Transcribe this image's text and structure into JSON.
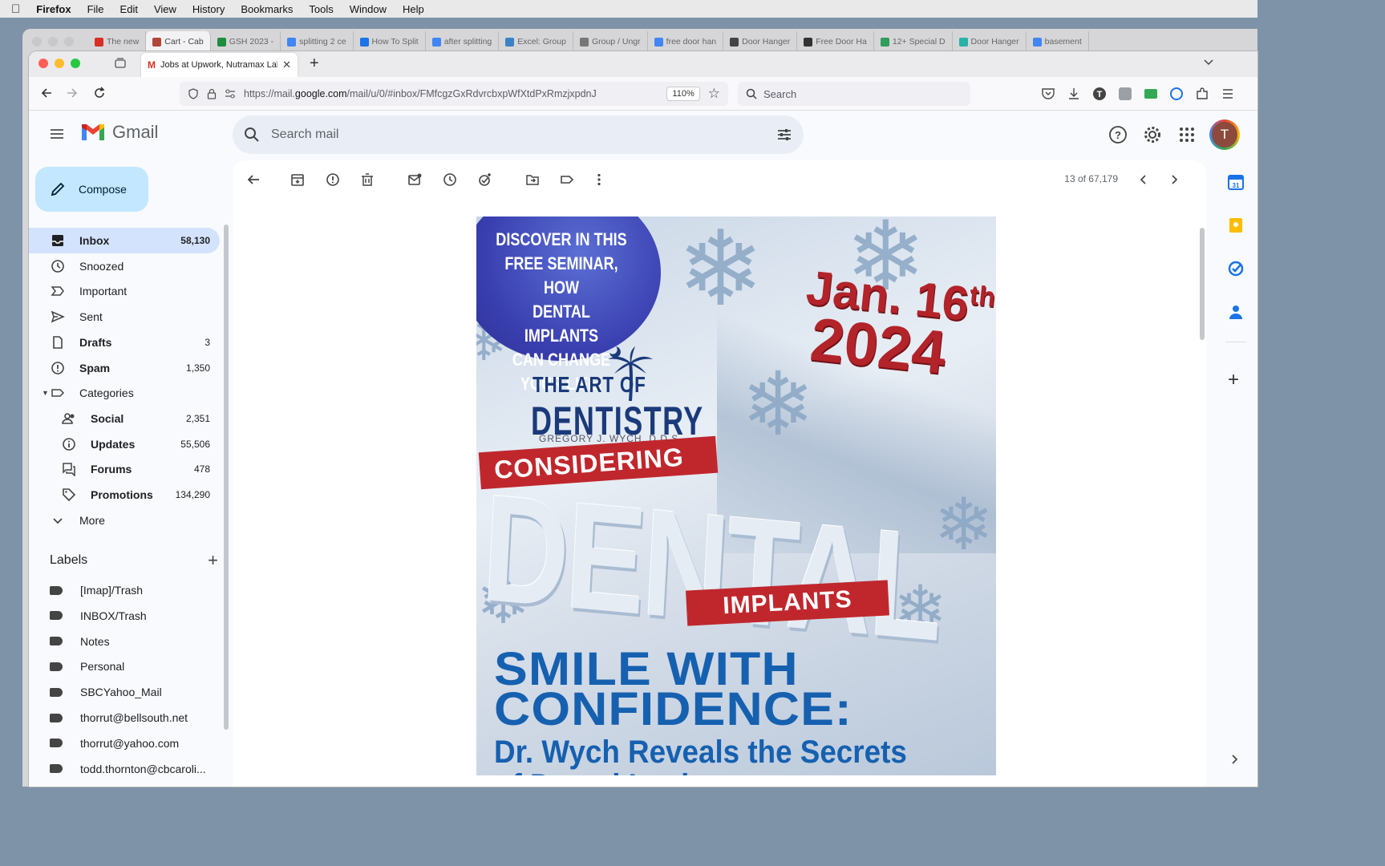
{
  "menubar": {
    "app": "Firefox",
    "items": [
      "File",
      "Edit",
      "View",
      "History",
      "Bookmarks",
      "Tools",
      "Window",
      "Help"
    ]
  },
  "back_tabs": [
    {
      "label": "The new",
      "color": "#d93025"
    },
    {
      "label": "Cart - Cab",
      "color": "#b0463a"
    },
    {
      "label": "GSH 2023 -",
      "color": "#1e8e3e"
    },
    {
      "label": "splitting 2 ce",
      "color": "#4285f4"
    },
    {
      "label": "How To Split",
      "color": "#1a73e8"
    },
    {
      "label": "after splitting",
      "color": "#4285f4"
    },
    {
      "label": "Excel: Group",
      "color": "#3b82c4"
    },
    {
      "label": "Group / Ungr",
      "color": "#777777"
    },
    {
      "label": "free door han",
      "color": "#4285f4"
    },
    {
      "label": "Door Hanger",
      "color": "#444444"
    },
    {
      "label": "Free Door Ha",
      "color": "#333333"
    },
    {
      "label": "12+ Special D",
      "color": "#2e9e5b"
    },
    {
      "label": "Door Hanger",
      "color": "#27b3a6"
    },
    {
      "label": "basement",
      "color": "#4285f4"
    }
  ],
  "active_tab": {
    "label": "Jobs at Upwork, Nutramax Lab"
  },
  "url": {
    "prefix": "https://mail.",
    "domain": "google.com",
    "suffix": "/mail/u/0/#inbox/FMfcgzGxRdvrcbxpWfXtdPxRmzjxpdnJ",
    "zoom": "110%"
  },
  "browser_search": {
    "placeholder": "Search"
  },
  "gmail": {
    "logo_text": "Gmail",
    "search_placeholder": "Search mail",
    "avatar_letter": "T",
    "compose": "Compose",
    "nav": [
      {
        "label": "Inbox",
        "count": "58,130",
        "icon": "inbox-icon",
        "active": true
      },
      {
        "label": "Snoozed",
        "count": "",
        "icon": "clock-icon"
      },
      {
        "label": "Important",
        "count": "",
        "icon": "important-icon"
      },
      {
        "label": "Sent",
        "count": "",
        "icon": "send-icon"
      },
      {
        "label": "Drafts",
        "count": "3",
        "icon": "draft-icon",
        "bold": true
      },
      {
        "label": "Spam",
        "count": "1,350",
        "icon": "spam-icon",
        "bold": true
      },
      {
        "label": "Categories",
        "count": "",
        "icon": "label-icon"
      }
    ],
    "categories": [
      {
        "label": "Social",
        "count": "2,351",
        "icon": "people-icon"
      },
      {
        "label": "Updates",
        "count": "55,506",
        "icon": "info-icon"
      },
      {
        "label": "Forums",
        "count": "478",
        "icon": "forum-icon"
      },
      {
        "label": "Promotions",
        "count": "134,290",
        "icon": "tag-icon"
      }
    ],
    "more": "More",
    "labels_header": "Labels",
    "labels": [
      "[Imap]/Trash",
      "INBOX/Trash",
      "Notes",
      "Personal",
      "SBCYahoo_Mail",
      "thorrut@bellsouth.net",
      "thorrut@yahoo.com",
      "todd.thornton@cbcaroli..."
    ],
    "pager": "13 of 67,179"
  },
  "poster": {
    "circle_lines": [
      "DISCOVER IN THIS",
      "FREE SEMINAR, HOW",
      "DENTAL IMPLANTS",
      "CAN CHANGE",
      "YOUR LIFE!"
    ],
    "date_line1": "Jan. 16",
    "date_sup": "th",
    "date_line2": "2024",
    "art_of": "THE ART OF",
    "dentistry": "DENTISTRY",
    "doctor": "GREGORY J. WYCH, D.D.S.",
    "considering": "CONSIDERING",
    "dental": "DENTAL",
    "implants": "IMPLANTS",
    "smile": "SMILE WITH",
    "confidence": "CONFIDENCE:",
    "reveals": "Dr. Wych Reveals the Secrets",
    "reveals2": "of Dental Implants"
  },
  "colors": {
    "accent": "#d3e3fd",
    "compose": "#c2e7ff",
    "poster_red": "#c0272d",
    "poster_blue": "#1660b0"
  }
}
